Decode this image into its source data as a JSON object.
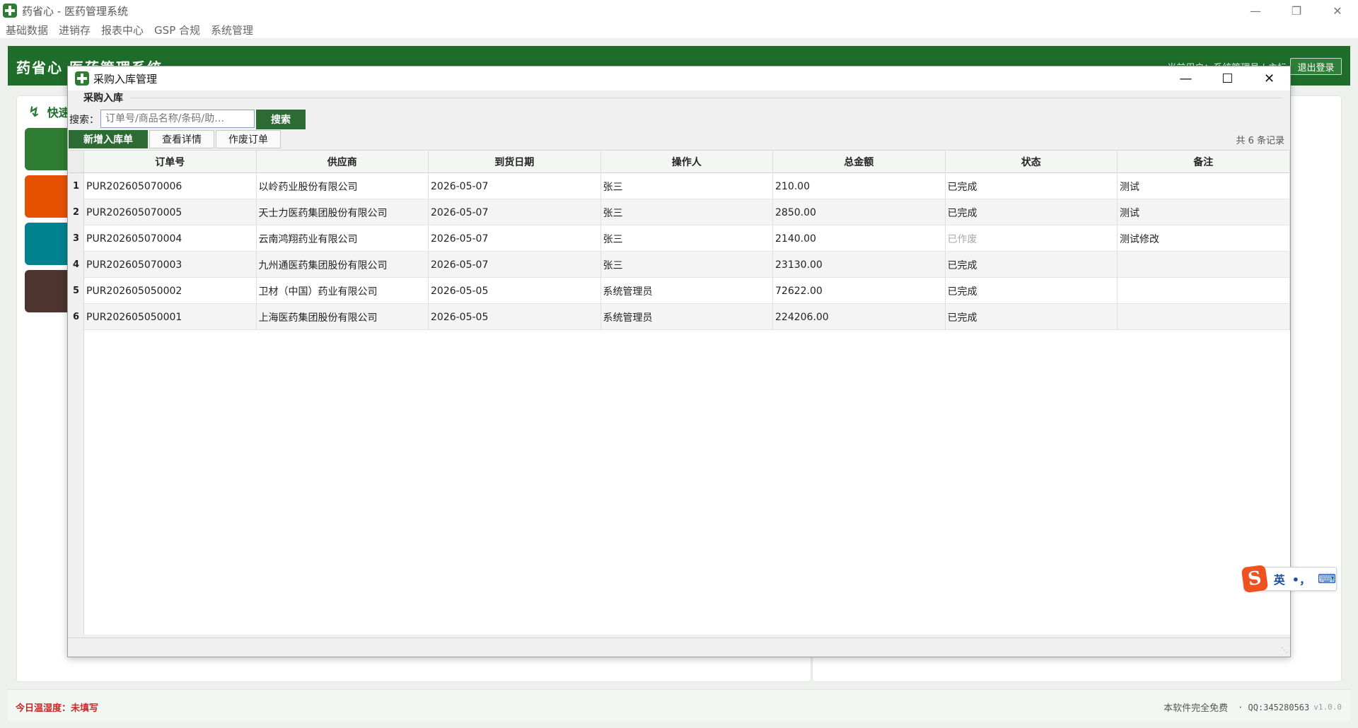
{
  "app": {
    "title": "药省心 - 医药管理系统",
    "menu": [
      "基础数据",
      "进销存",
      "报表中心",
      "GSP 合规",
      "系统管理"
    ],
    "header_title": "药省心 医药管理系统",
    "header_user": "当前用户：系统管理员 | 主标",
    "logout_label": "退出登录",
    "quick_title": "快速",
    "quick_tiles": [
      {
        "color": "#2e7d32"
      },
      {
        "color": "#e65100"
      },
      {
        "color": "#00838f"
      },
      {
        "color": "#4e342e"
      }
    ]
  },
  "status": {
    "temp_label": "今日温湿度：",
    "temp_value": "未填写",
    "free_text": "本软件完全免费",
    "qq": "· QQ:345280563",
    "version": "v1.0.0"
  },
  "dialog": {
    "title": "采购入库管理",
    "group_label": "采购入库",
    "search_label": "搜索：",
    "search_placeholder": "订单号/商品名称/条码/助…",
    "search_button": "搜索",
    "buttons": {
      "new": "新增入库单",
      "detail": "查看详情",
      "void": "作废订单"
    },
    "record_count": "共 6 条记录",
    "columns": [
      "订单号",
      "供应商",
      "到货日期",
      "操作人",
      "总金额",
      "状态",
      "备注"
    ],
    "rows": [
      {
        "no": "1",
        "order": "PUR202605070006",
        "supplier": "以岭药业股份有限公司",
        "date": "2026-05-07",
        "operator": "张三",
        "amount": "210.00",
        "status": "已完成",
        "remark": "测试"
      },
      {
        "no": "2",
        "order": "PUR202605070005",
        "supplier": "天士力医药集团股份有限公司",
        "date": "2026-05-07",
        "operator": "张三",
        "amount": "2850.00",
        "status": "已完成",
        "remark": "测试"
      },
      {
        "no": "3",
        "order": "PUR202605070004",
        "supplier": "云南鸿翔药业有限公司",
        "date": "2026-05-07",
        "operator": "张三",
        "amount": "2140.00",
        "status": "已作废",
        "remark": "测试修改"
      },
      {
        "no": "4",
        "order": "PUR202605070003",
        "supplier": "九州通医药集团股份有限公司",
        "date": "2026-05-07",
        "operator": "张三",
        "amount": "23130.00",
        "status": "已完成",
        "remark": ""
      },
      {
        "no": "5",
        "order": "PUR202605050002",
        "supplier": "卫材（中国）药业有限公司",
        "date": "2026-05-05",
        "operator": "系统管理员",
        "amount": "72622.00",
        "status": "已完成",
        "remark": ""
      },
      {
        "no": "6",
        "order": "PUR202605050001",
        "supplier": "上海医药集团股份有限公司",
        "date": "2026-05-05",
        "operator": "系统管理员",
        "amount": "224206.00",
        "status": "已完成",
        "remark": ""
      }
    ]
  },
  "ime": {
    "logo": "S",
    "lang": "英",
    "punct": "•，",
    "keyboard_icon": "⌨"
  }
}
